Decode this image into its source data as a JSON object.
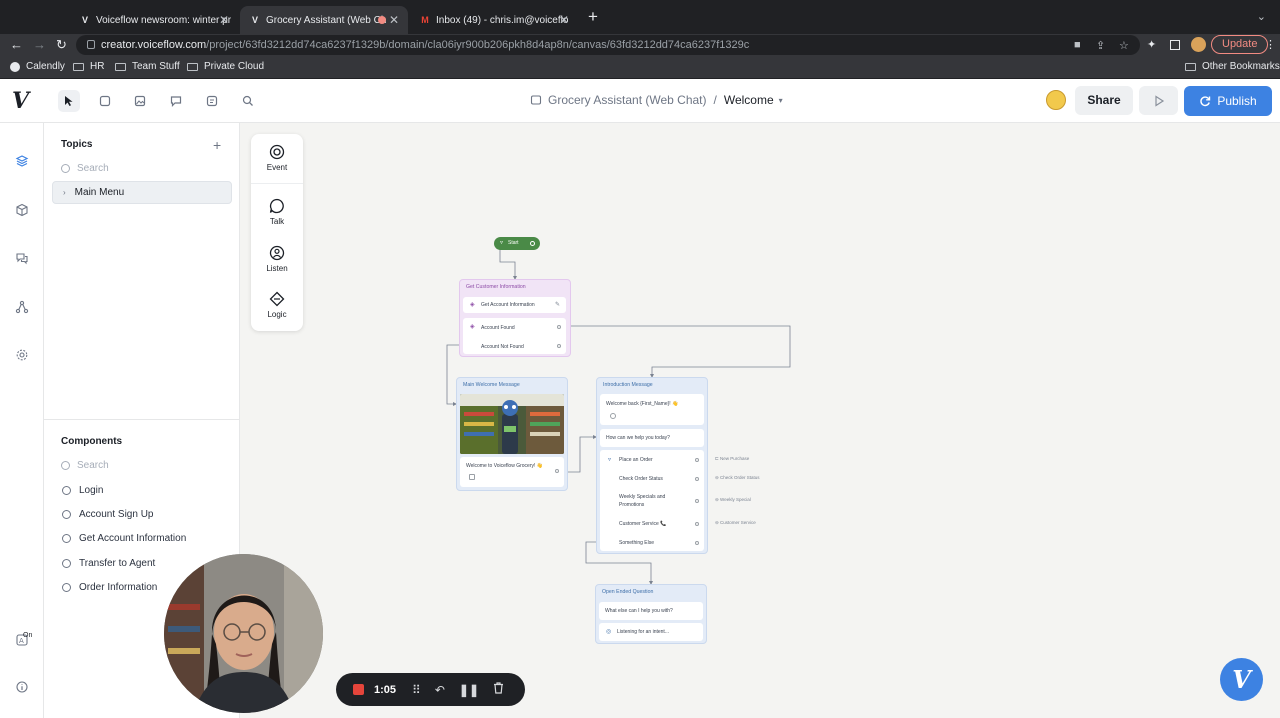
{
  "browser": {
    "tabs": [
      {
        "title": "Voiceflow newsroom: winter pr",
        "icon": "voiceflow-icon"
      },
      {
        "title": "Grocery Assistant (Web Ch",
        "icon": "voiceflow-icon"
      },
      {
        "title": "Inbox (49) - chris.im@voiceflo",
        "icon": "gmail-icon"
      }
    ],
    "url_host": "creator.voiceflow.com",
    "url_path": "/project/63fd3212dd74ca6237f1329b/domain/cla06iyr900b206pkh8d4ap8n/canvas/63fd3212dd74ca6237f1329c",
    "update_label": "Update",
    "bookmarks": [
      "Calendly",
      "HR",
      "Team Stuff",
      "Private Cloud"
    ],
    "other_bookmarks": "Other Bookmarks"
  },
  "header": {
    "project": "Grocery Assistant (Web Chat)",
    "separator": "/",
    "topic": "Welcome",
    "share_label": "Share",
    "publish_label": "Publish"
  },
  "sidebar": {
    "topics_title": "Topics",
    "search_placeholder": "Search",
    "topic_item": "Main Menu",
    "components_title": "Components",
    "components_search": "Search",
    "components": [
      "Login",
      "Account Sign Up",
      "Get Account Information",
      "Transfer to Agent",
      "Order Information"
    ]
  },
  "steps_menu": [
    "Event",
    "Talk",
    "Listen",
    "Logic"
  ],
  "canvas": {
    "start": "Start",
    "customer": {
      "title": "Get Customer Information",
      "component": "Get Account Information",
      "paths": [
        "Account Found",
        "Account Not Found"
      ]
    },
    "welcome": {
      "title": "Main Welcome Message",
      "text": "Welcome to Voiceflow Grocery! 👋"
    },
    "intro": {
      "title": "Introduction Message",
      "greeting": "Welcome back {First_Name}! 👋",
      "question": "How can we help you today?",
      "choices": [
        "Place an Order",
        "Check Order Status",
        "Weekly Specials and",
        "Promotions",
        "Customer Service 📞",
        "Something Else"
      ],
      "targets": [
        "New Purchase",
        "Check Order Status",
        "Weekly Special",
        "Customer Service"
      ]
    },
    "open": {
      "title": "Open Ended Question",
      "question": "What else can I help you with?",
      "listening": "Listening for an intent..."
    }
  },
  "recorder": {
    "time": "1:05"
  },
  "rail_badge": "On",
  "colors": {
    "publish": "#3d82e2",
    "start": "#4a8a47",
    "purple_block": "#f1e4f6",
    "blue_block": "#e3ebf7",
    "record": "#e5453b"
  }
}
